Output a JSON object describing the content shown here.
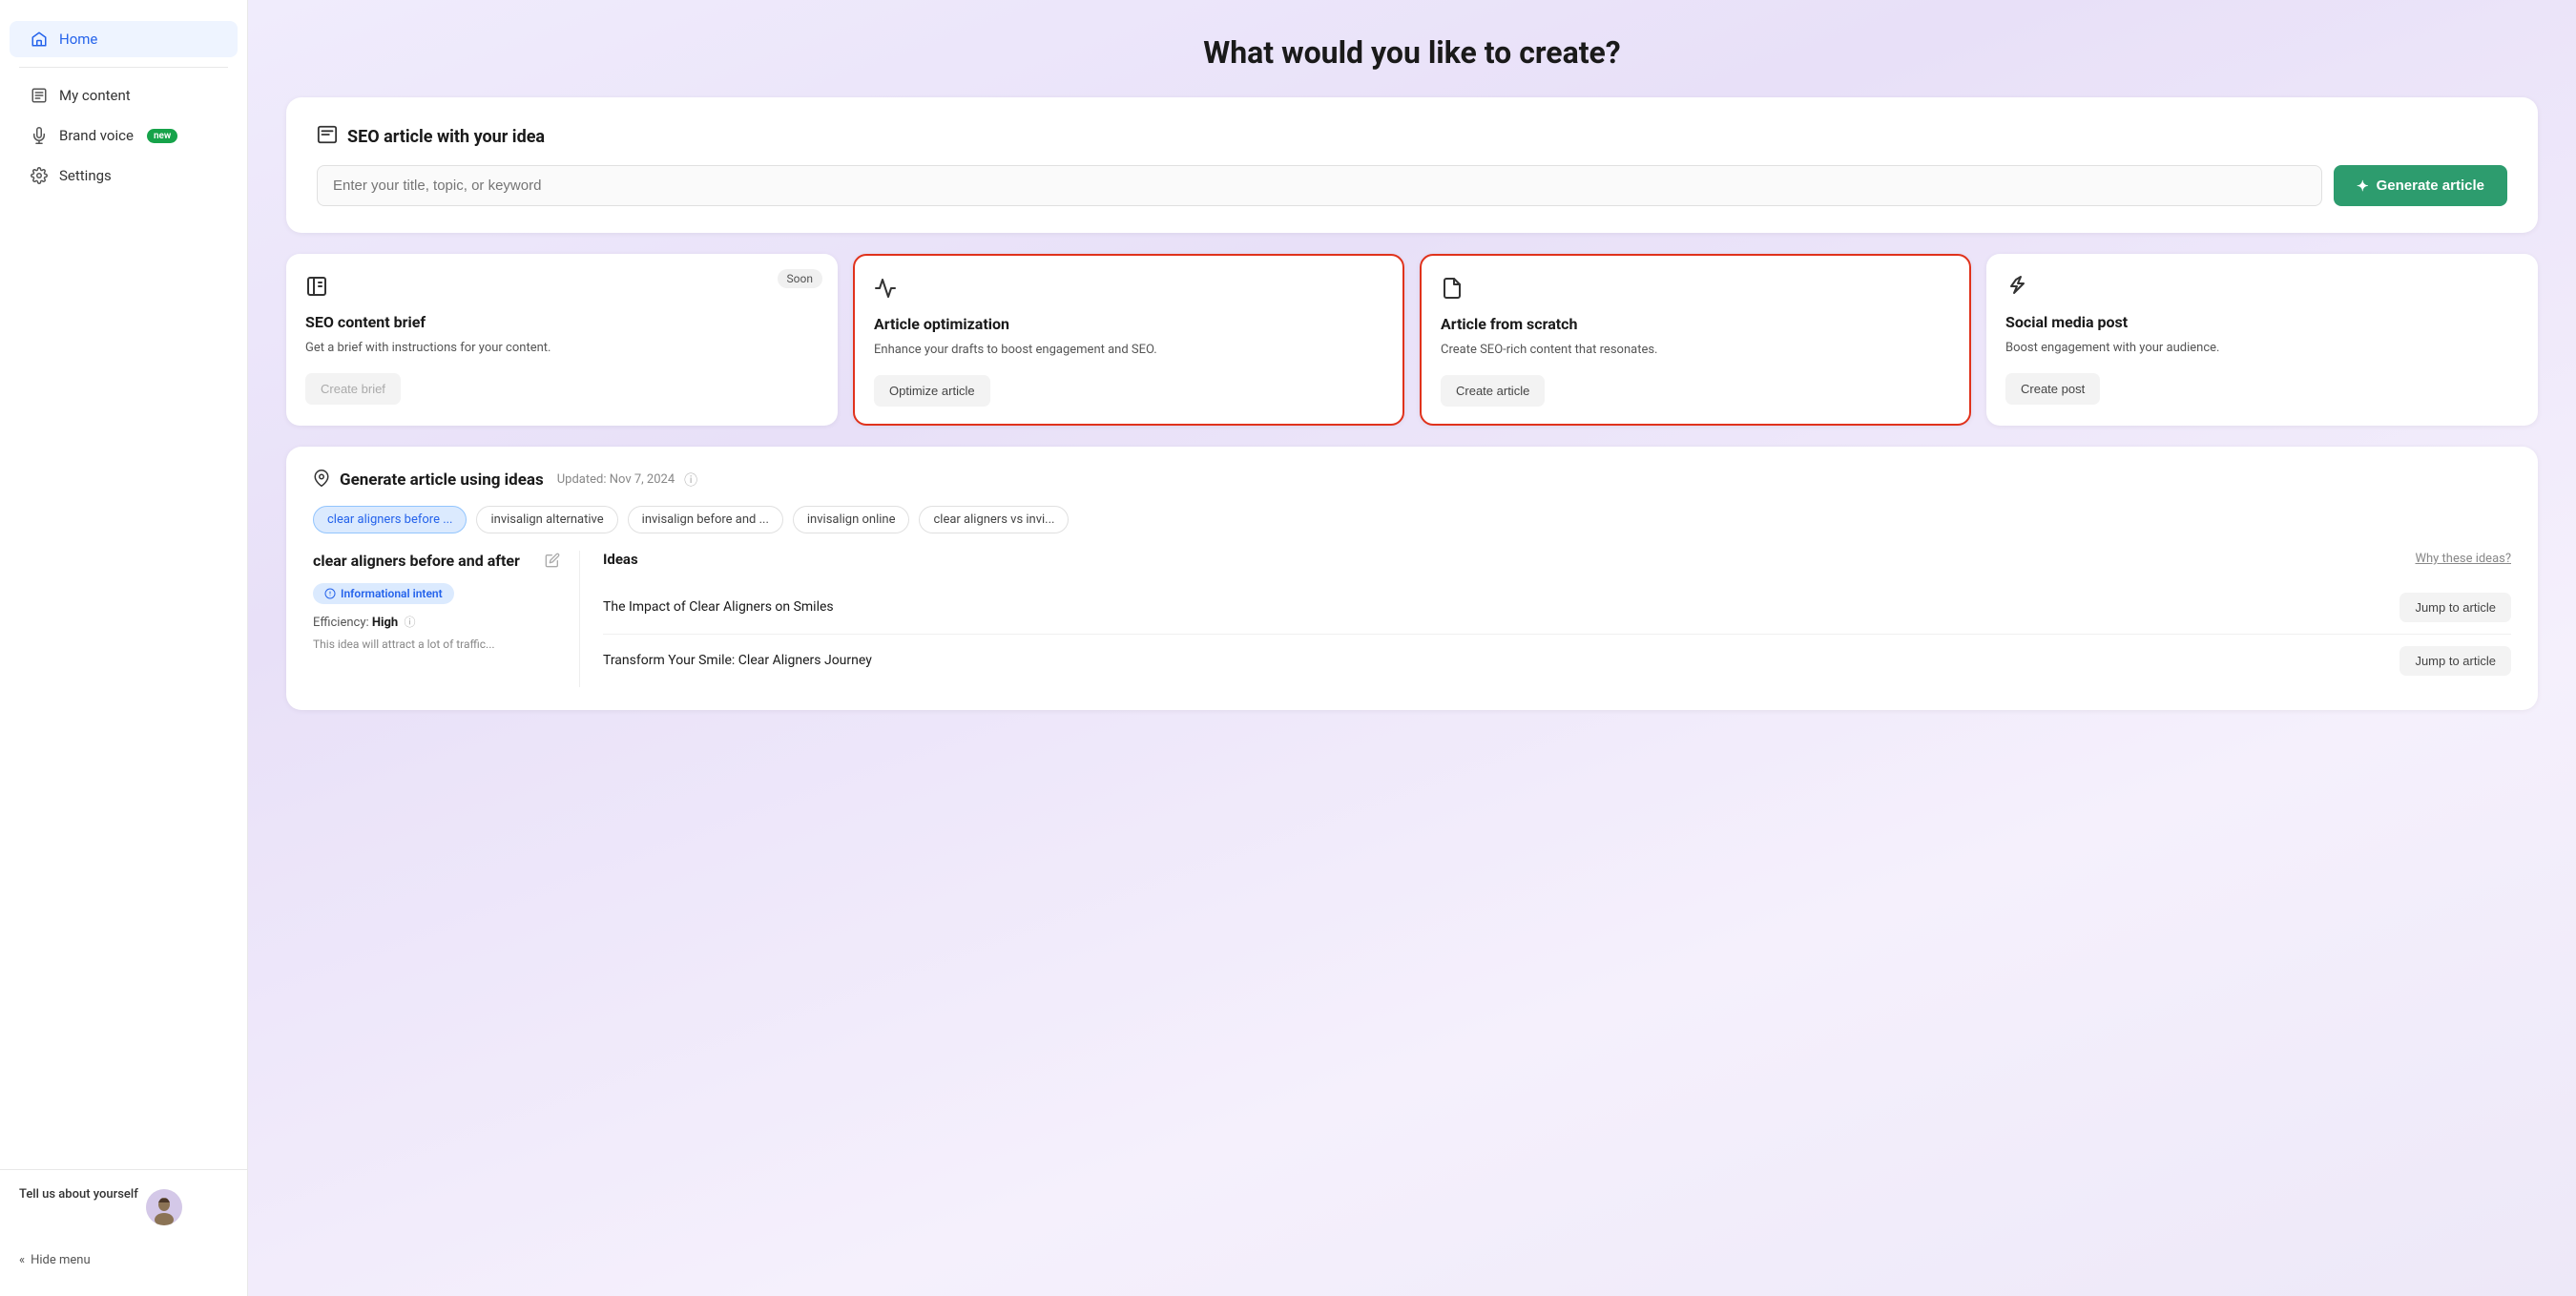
{
  "sidebar": {
    "items": [
      {
        "id": "home",
        "label": "Home",
        "icon": "🏠",
        "active": true
      },
      {
        "id": "my-content",
        "label": "My content",
        "icon": "📋",
        "active": false
      },
      {
        "id": "brand-voice",
        "label": "Brand voice",
        "icon": "🎤",
        "active": false,
        "badge": "new"
      },
      {
        "id": "settings",
        "label": "Settings",
        "icon": "⚙️",
        "active": false
      }
    ],
    "footer": {
      "tell_us_label": "Tell us about yourself",
      "hide_menu_label": "Hide menu"
    }
  },
  "main": {
    "page_title": "What would you like to create?",
    "seo_section": {
      "title": "SEO article with your idea",
      "input_placeholder": "Enter your title, topic, or keyword",
      "generate_btn": "Generate article"
    },
    "feature_cards": [
      {
        "id": "seo-brief",
        "icon": "📰",
        "title": "SEO content brief",
        "desc": "Get a brief with instructions for your content.",
        "btn_label": "Create brief",
        "soon": true,
        "highlighted": false,
        "disabled": true
      },
      {
        "id": "article-optimization",
        "icon": "📈",
        "title": "Article optimization",
        "desc": "Enhance your drafts to boost engagement and SEO.",
        "btn_label": "Optimize article",
        "soon": false,
        "highlighted": true,
        "disabled": false
      },
      {
        "id": "article-scratch",
        "icon": "📄",
        "title": "Article from scratch",
        "desc": "Create SEO-rich content that resonates.",
        "btn_label": "Create article",
        "soon": false,
        "highlighted": true,
        "disabled": false
      },
      {
        "id": "social-media",
        "icon": "📣",
        "title": "Social media post",
        "desc": "Boost engagement with your audience.",
        "btn_label": "Create post",
        "soon": false,
        "highlighted": false,
        "disabled": false
      }
    ],
    "ideas_section": {
      "title": "Generate article using ideas",
      "updated": "Updated: Nov 7, 2024",
      "tags": [
        {
          "label": "clear aligners before ...",
          "active": true
        },
        {
          "label": "invisalign alternative",
          "active": false
        },
        {
          "label": "invisalign before and ...",
          "active": false
        },
        {
          "label": "invisalign online",
          "active": false
        },
        {
          "label": "clear aligners vs invi...",
          "active": false
        }
      ],
      "article": {
        "title": "clear aligners before and after",
        "intent_label": "Informational intent",
        "efficiency_label": "Efficiency:",
        "efficiency_value": "High",
        "desc": "This idea will attract a lot of traffic..."
      },
      "ideas_list": {
        "title": "Ideas",
        "why_label": "Why these ideas?",
        "items": [
          {
            "text": "The Impact of Clear Aligners on Smiles",
            "btn": "Jump to article"
          },
          {
            "text": "Transform Your Smile: Clear Aligners Journey",
            "btn": "Jump to article"
          }
        ]
      }
    }
  }
}
